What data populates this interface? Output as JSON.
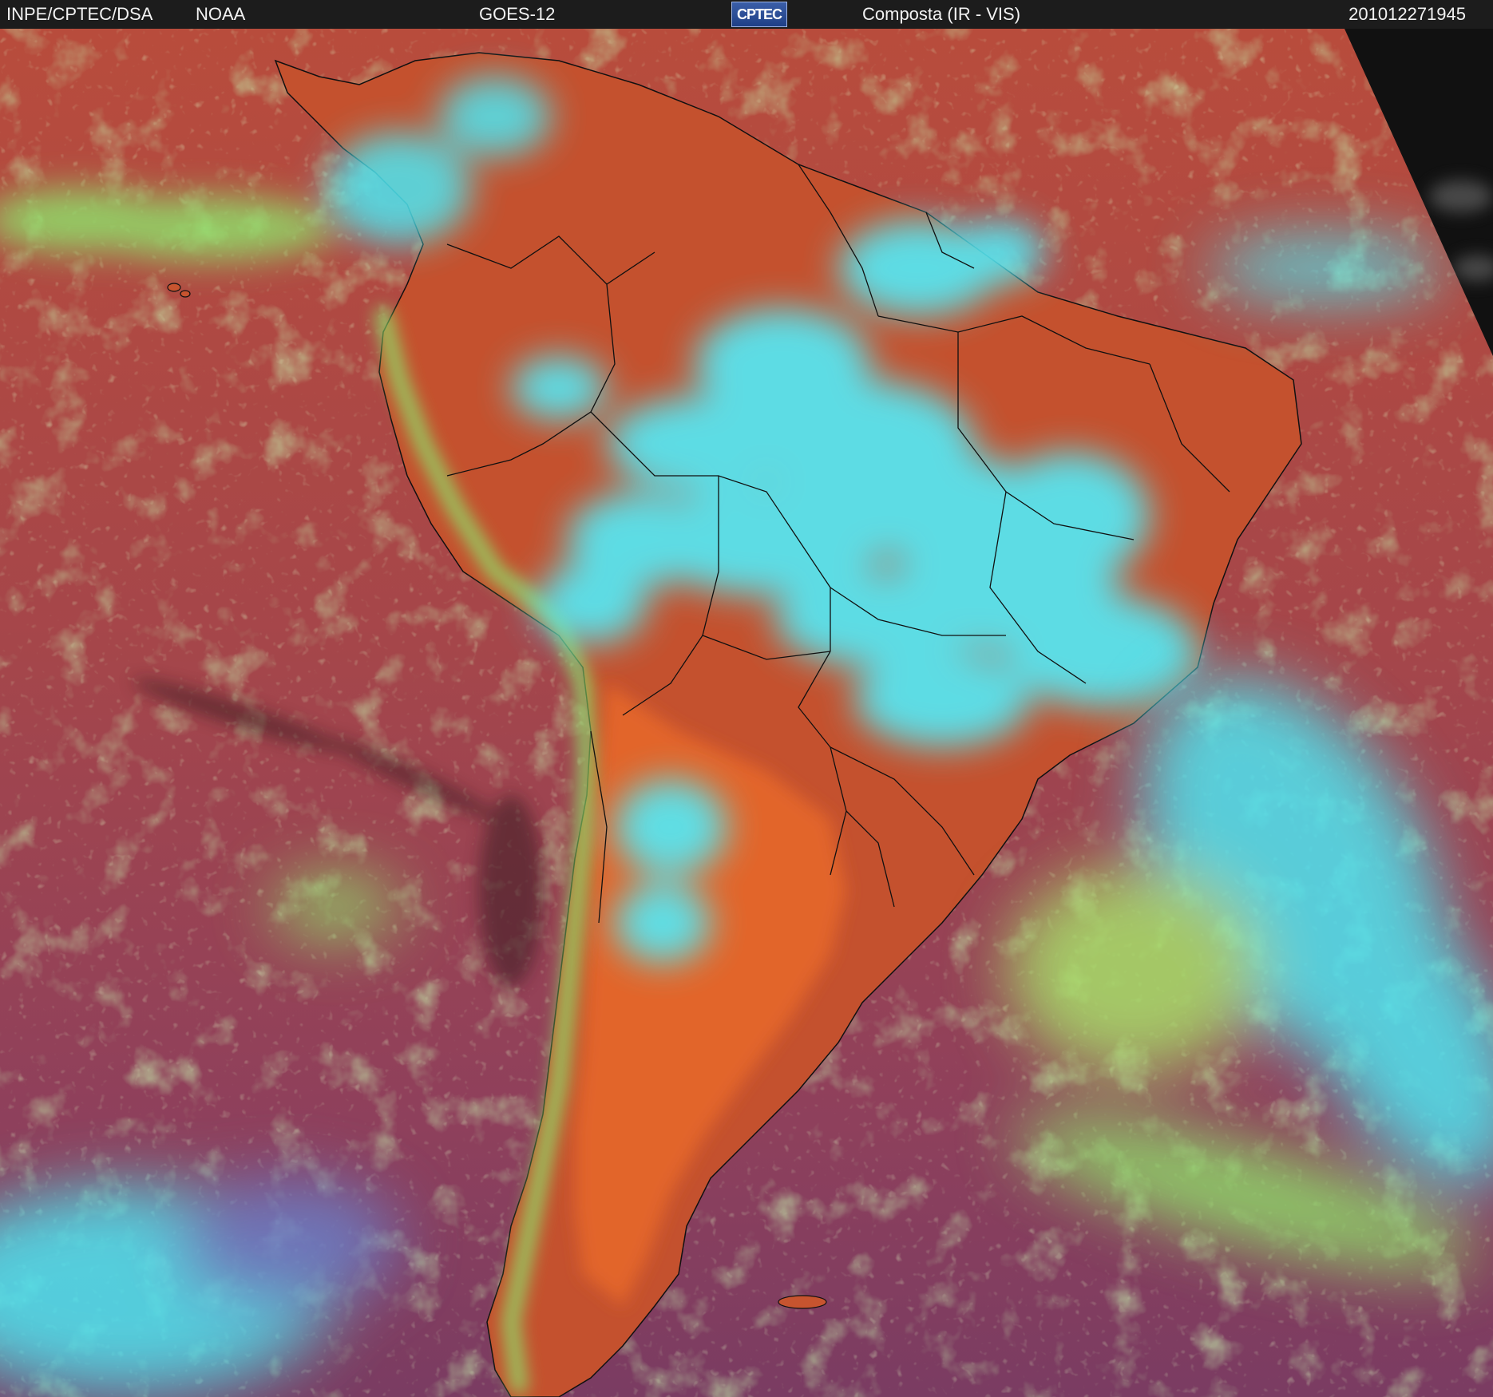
{
  "header": {
    "agency": "INPE/CPTEC/DSA",
    "partner": "NOAA",
    "satellite": "GOES-12",
    "logo_text": "CPTEC",
    "product": "Composta (IR - VIS)",
    "timestamp": "201012271945"
  },
  "image": {
    "ocean_color": "#a24848",
    "land_color": "#c4512e",
    "land_dry_color": "#e06426",
    "high_cloud_color": "#4ee6f2",
    "mid_cloud_color": "#8fe06a",
    "low_cloud_color": "#6b7fc8",
    "space_color": "#111111",
    "border_color": "#101010"
  }
}
